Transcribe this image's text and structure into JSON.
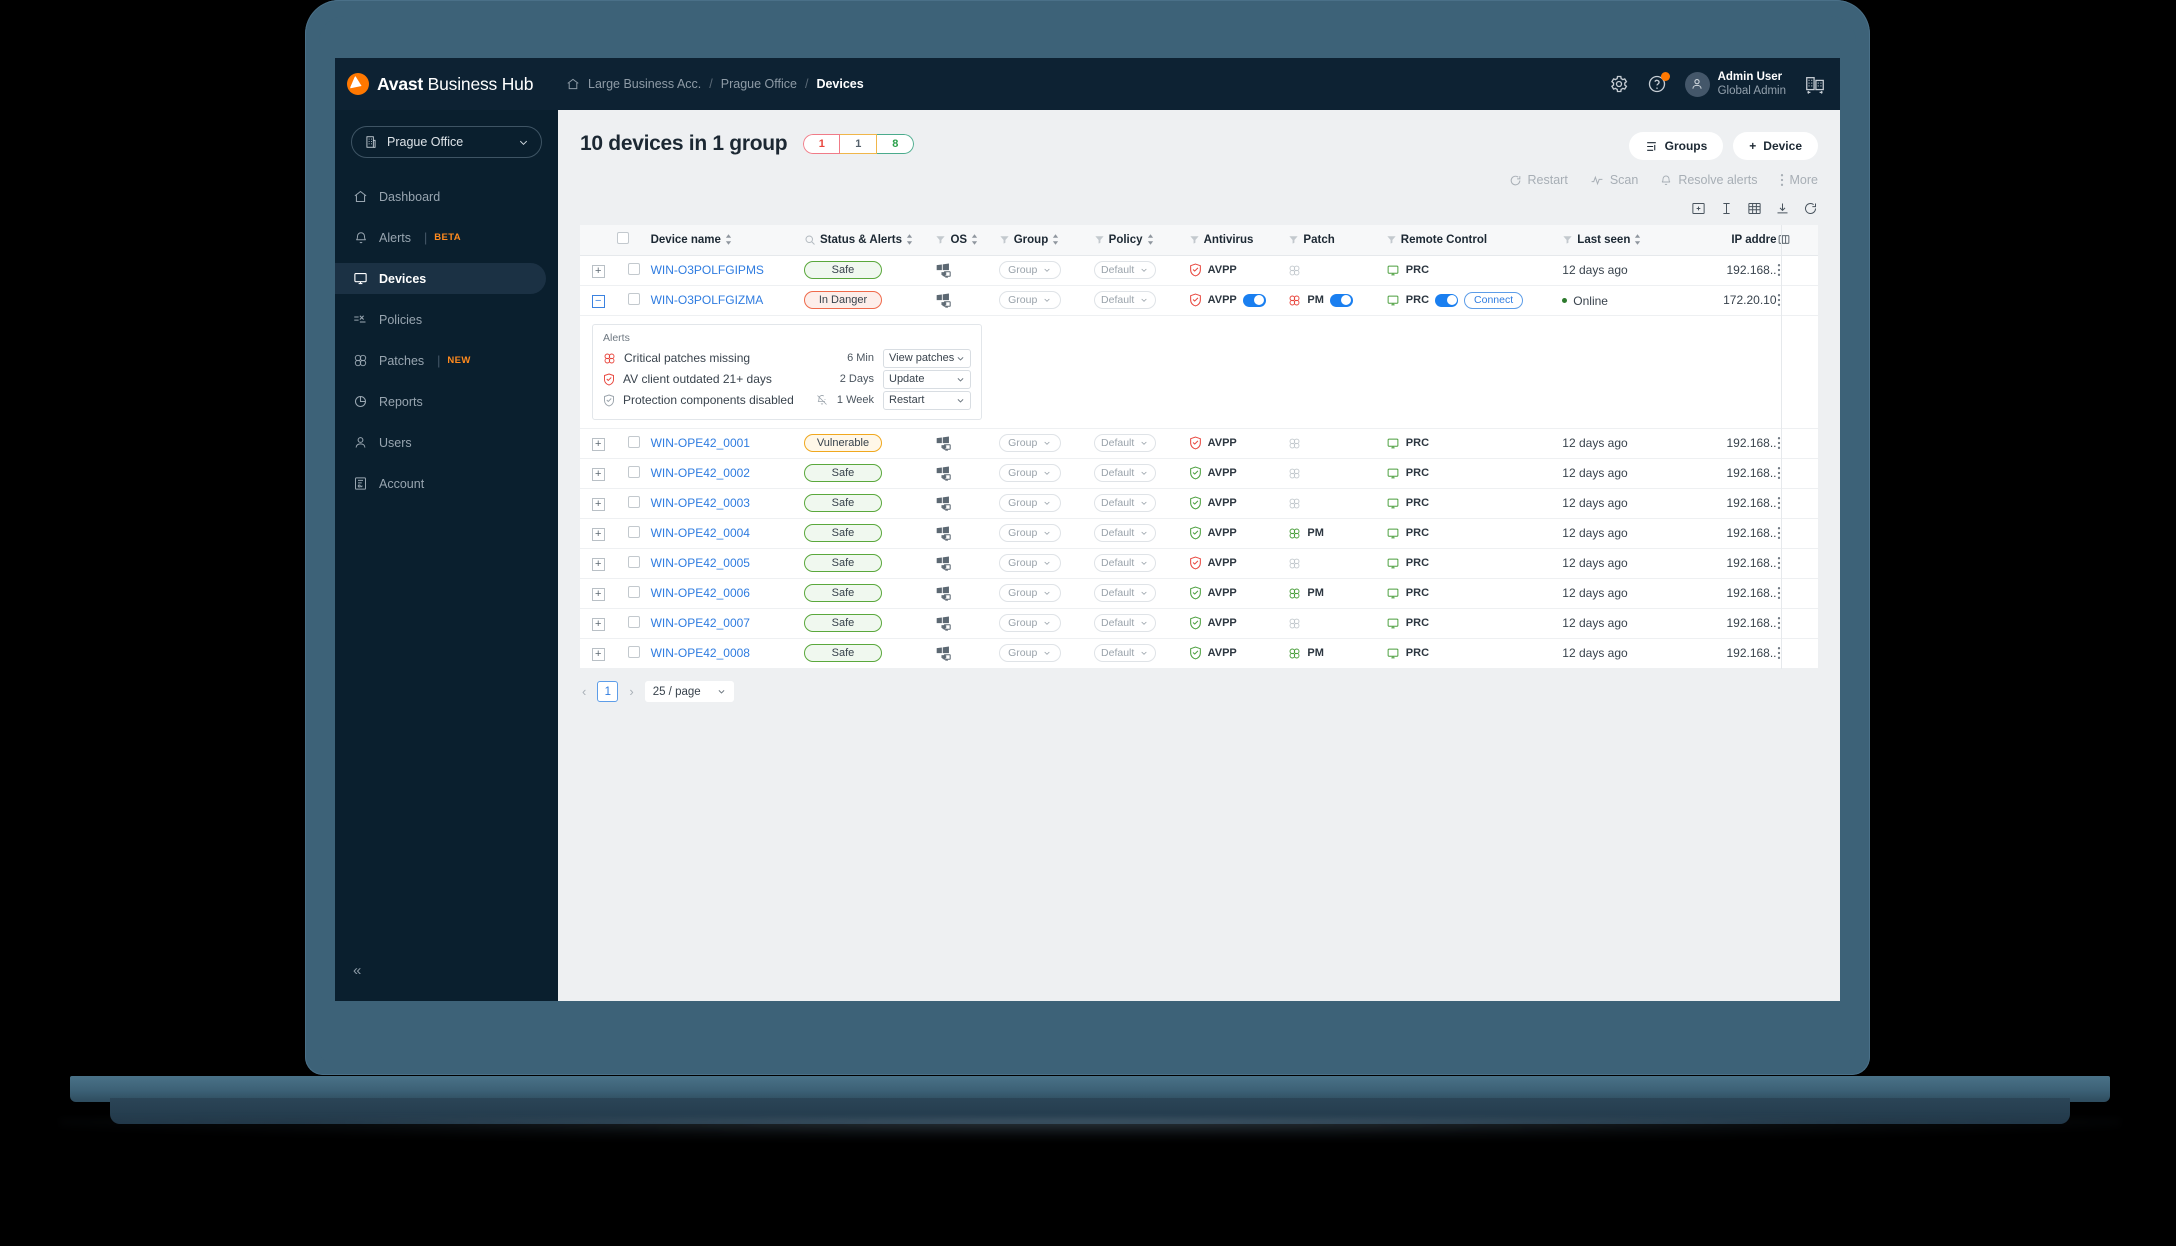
{
  "topbar": {
    "brand_bold": "Avast",
    "brand_rest": " Business Hub",
    "breadcrumb": [
      "Large Business Acc.",
      "Prague Office",
      "Devices"
    ],
    "breadcrumb_sep": "/",
    "settings_icon": "gear-icon",
    "help_icon": "help-circle-icon",
    "user_name": "Admin User",
    "user_role": "Global Admin",
    "switch_icon": "company-switch-icon"
  },
  "sidebar": {
    "office": "Prague Office",
    "items": [
      {
        "label": "Dashboard",
        "icon": "home-icon",
        "badge": ""
      },
      {
        "label": "Alerts",
        "icon": "bell-icon",
        "badge": "BETA"
      },
      {
        "label": "Devices",
        "icon": "monitor-icon",
        "badge": ""
      },
      {
        "label": "Policies",
        "icon": "policies-icon",
        "badge": ""
      },
      {
        "label": "Patches",
        "icon": "patch-icon",
        "badge": "NEW"
      },
      {
        "label": "Reports",
        "icon": "pie-chart-icon",
        "badge": ""
      },
      {
        "label": "Users",
        "icon": "user-icon",
        "badge": ""
      },
      {
        "label": "Account",
        "icon": "account-icon",
        "badge": ""
      }
    ],
    "active_index": 2,
    "collapse_glyph": "«"
  },
  "main": {
    "title": "10 devices in 1 group",
    "counters": {
      "danger": "1",
      "warning": "1",
      "safe": "8"
    },
    "groups_button": "Groups",
    "device_button": "Device",
    "device_button_plus": "+",
    "sub_actions": [
      {
        "label": "Restart",
        "icon": "restart-icon"
      },
      {
        "label": "Scan",
        "icon": "scan-icon"
      },
      {
        "label": "Resolve alerts",
        "icon": "bell-icon"
      },
      {
        "label": "More",
        "icon": "kebab-icon"
      }
    ],
    "tool_icons": [
      "add-column-icon",
      "row-height-icon",
      "grid-view-icon",
      "download-icon",
      "refresh-icon"
    ]
  },
  "table": {
    "columns": [
      {
        "key": "device_name",
        "label": "Device name",
        "sortable": true,
        "search": true
      },
      {
        "key": "status",
        "label": "Status & Alerts",
        "sortable": true,
        "filter": true
      },
      {
        "key": "os",
        "label": "OS",
        "sortable": true,
        "filter": true
      },
      {
        "key": "group",
        "label": "Group",
        "sortable": true,
        "filter": true
      },
      {
        "key": "policy",
        "label": "Policy",
        "sortable": true,
        "filter": true
      },
      {
        "key": "antivirus",
        "label": "Antivirus",
        "filter": true
      },
      {
        "key": "patch",
        "label": "Patch",
        "filter": true
      },
      {
        "key": "remote_control",
        "label": "Remote Control",
        "filter": true
      },
      {
        "key": "last_seen",
        "label": "Last seen",
        "sortable": true,
        "filter": true
      },
      {
        "key": "ip",
        "label": "IP addre"
      }
    ],
    "columns_icon": "columns-settings-icon",
    "group_placeholder": "Group",
    "policy_placeholder": "Default",
    "av_label": "AVPP",
    "pm_label": "PM",
    "prc_label": "PRC",
    "connect_label": "Connect",
    "online_label": "Online",
    "rows": [
      {
        "name": "WIN-O3POLFGIPMS",
        "status": "Safe",
        "status_kind": "safe",
        "av_state": "danger",
        "patch": "off",
        "prc_toggle": false,
        "last_seen": "12 days ago",
        "ip": "192.168..",
        "expanded": false
      },
      {
        "name": "WIN-O3POLFGIZMA",
        "status": "In Danger",
        "status_kind": "danger",
        "av_state": "danger",
        "patch": "on",
        "prc_toggle": true,
        "connect": true,
        "last_seen": "Online",
        "last_seen_online": true,
        "ip": "172.20.10",
        "expanded": true
      },
      {
        "name": "WIN-OPE42_0001",
        "status": "Vulnerable",
        "status_kind": "vulnerable",
        "av_state": "danger",
        "patch": "off",
        "prc_toggle": false,
        "last_seen": "12 days ago",
        "ip": "192.168..",
        "expanded": false
      },
      {
        "name": "WIN-OPE42_0002",
        "status": "Safe",
        "status_kind": "safe",
        "av_state": "ok",
        "patch": "off",
        "prc_toggle": false,
        "last_seen": "12 days ago",
        "ip": "192.168..",
        "expanded": false
      },
      {
        "name": "WIN-OPE42_0003",
        "status": "Safe",
        "status_kind": "safe",
        "av_state": "ok",
        "patch": "off",
        "prc_toggle": false,
        "last_seen": "12 days ago",
        "ip": "192.168..",
        "expanded": false
      },
      {
        "name": "WIN-OPE42_0004",
        "status": "Safe",
        "status_kind": "safe",
        "av_state": "ok",
        "patch": "on",
        "prc_toggle": false,
        "last_seen": "12 days ago",
        "ip": "192.168..",
        "expanded": false
      },
      {
        "name": "WIN-OPE42_0005",
        "status": "Safe",
        "status_kind": "safe",
        "av_state": "danger",
        "patch": "off",
        "prc_toggle": false,
        "last_seen": "12 days ago",
        "ip": "192.168..",
        "expanded": false
      },
      {
        "name": "WIN-OPE42_0006",
        "status": "Safe",
        "status_kind": "safe",
        "av_state": "ok",
        "patch": "on",
        "prc_toggle": false,
        "last_seen": "12 days ago",
        "ip": "192.168..",
        "expanded": false
      },
      {
        "name": "WIN-OPE42_0007",
        "status": "Safe",
        "status_kind": "safe",
        "av_state": "ok",
        "patch": "off",
        "prc_toggle": false,
        "last_seen": "12 days ago",
        "ip": "192.168..",
        "expanded": false
      },
      {
        "name": "WIN-OPE42_0008",
        "status": "Safe",
        "status_kind": "safe",
        "av_state": "ok",
        "patch": "on",
        "prc_toggle": false,
        "last_seen": "12 days ago",
        "ip": "192.168..",
        "expanded": false
      }
    ]
  },
  "alerts_panel": {
    "title": "Alerts",
    "items": [
      {
        "text": "Critical patches missing",
        "icon": "patch-icon",
        "icon_color": "#e8453c",
        "age": "6 Min",
        "action": "View patches",
        "muted": false
      },
      {
        "text": "AV client outdated 21+ days",
        "icon": "shield-check-icon",
        "icon_color": "#e8453c",
        "age": "2 Days",
        "action": "Update",
        "muted": false
      },
      {
        "text": "Protection components disabled",
        "icon": "shield-check-icon",
        "icon_color": "#9aa3ab",
        "age": "1 Week",
        "action": "Restart",
        "muted": true
      }
    ]
  },
  "pagination": {
    "prev": "‹",
    "next": "›",
    "page": "1",
    "page_size": "25 / page"
  },
  "colors": {
    "topbar_bg": "#0d2233",
    "sidebar_bg": "#0a1f2e",
    "accent_orange": "#ff7800",
    "link_blue": "#2f7ce0",
    "toggle_blue": "#1a7ff0",
    "danger_red": "#e8453c",
    "safe_green": "#5aa83c",
    "warn_amber": "#f0a81e",
    "laptop_body": "#3d6278"
  }
}
